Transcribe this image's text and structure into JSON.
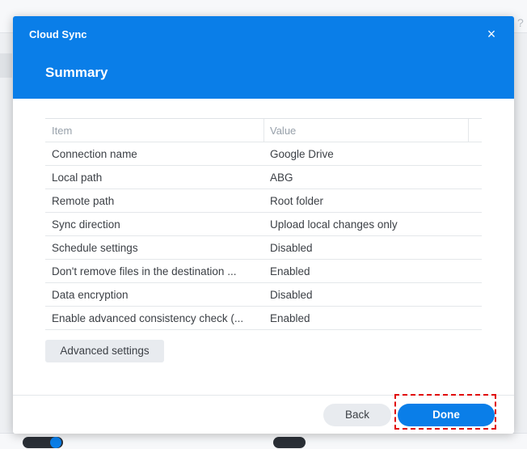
{
  "dialog": {
    "title": "Cloud Sync",
    "close_label": "×",
    "subtitle": "Summary"
  },
  "table": {
    "columns": [
      "Item",
      "Value"
    ],
    "rows": [
      {
        "item": "Connection name",
        "value": "Google Drive"
      },
      {
        "item": "Local path",
        "value": "ABG"
      },
      {
        "item": "Remote path",
        "value": "Root folder"
      },
      {
        "item": "Sync direction",
        "value": "Upload local changes only"
      },
      {
        "item": "Schedule settings",
        "value": "Disabled"
      },
      {
        "item": "Don't remove files in the destination ...",
        "value": "Enabled"
      },
      {
        "item": "Data encryption",
        "value": "Disabled"
      },
      {
        "item": "Enable advanced consistency check (...",
        "value": "Enabled"
      }
    ]
  },
  "buttons": {
    "advanced": "Advanced settings",
    "back": "Back",
    "done": "Done"
  },
  "colors": {
    "accent": "#0a7ee8",
    "highlight": "#e10000"
  }
}
